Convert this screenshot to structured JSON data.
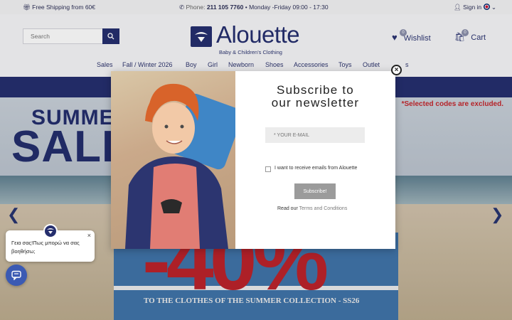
{
  "topbar": {
    "shipping": "Free Shipping from 60€",
    "phone_label": "Phone:",
    "phone_number": "211 105 7760",
    "hours": "• Monday -Friday 09:00 - 17:30",
    "sign_in": "Sign in"
  },
  "header": {
    "search_placeholder": "Search",
    "logo_text": "Alouette",
    "logo_subtitle": "Baby & Children's Clothing",
    "wishlist_label": "Wishlist",
    "wishlist_count": "0",
    "cart_label": "Cart",
    "cart_count": "0"
  },
  "nav": {
    "items": [
      "Sales",
      "Fall / Winter 2026",
      "Boy",
      "Girl",
      "Newborn",
      "Shoes",
      "Accessories",
      "Toys",
      "Outlet",
      "s"
    ]
  },
  "hero": {
    "summer": "SUMME",
    "sale": "SALE",
    "excluded_note": "*Selected codes are excluded.",
    "big_text": "-40%",
    "collection_text": "TO THE CLOTHES OF THE SUMMER COLLECTION - SS26"
  },
  "modal": {
    "title_line1": "Subscribe to",
    "title_line2": "our newsletter",
    "email_placeholder": "* YOUR E-MAIL",
    "consent_label": "I want to receive emails from Alouette",
    "subscribe_label": "Subscribe!",
    "terms_prefix": "Read our",
    "terms_link": "Terms and Conditions",
    "close_symbol": "×"
  },
  "chat": {
    "message": "Γεια σας!Πως μπορώ να σας βοηθήσω;",
    "close_symbol": "×"
  },
  "colors": {
    "brand_navy": "#252e6d",
    "accent_red": "#c1272d",
    "chat_blue": "#3b5ab3"
  },
  "icons": [
    "gift-icon",
    "phone-icon",
    "user-icon",
    "uk-flag-icon",
    "chevron-down-icon",
    "search-icon",
    "heart-icon",
    "cart-icon",
    "close-icon",
    "chevron-left-icon",
    "chevron-right-icon",
    "chat-icon"
  ]
}
